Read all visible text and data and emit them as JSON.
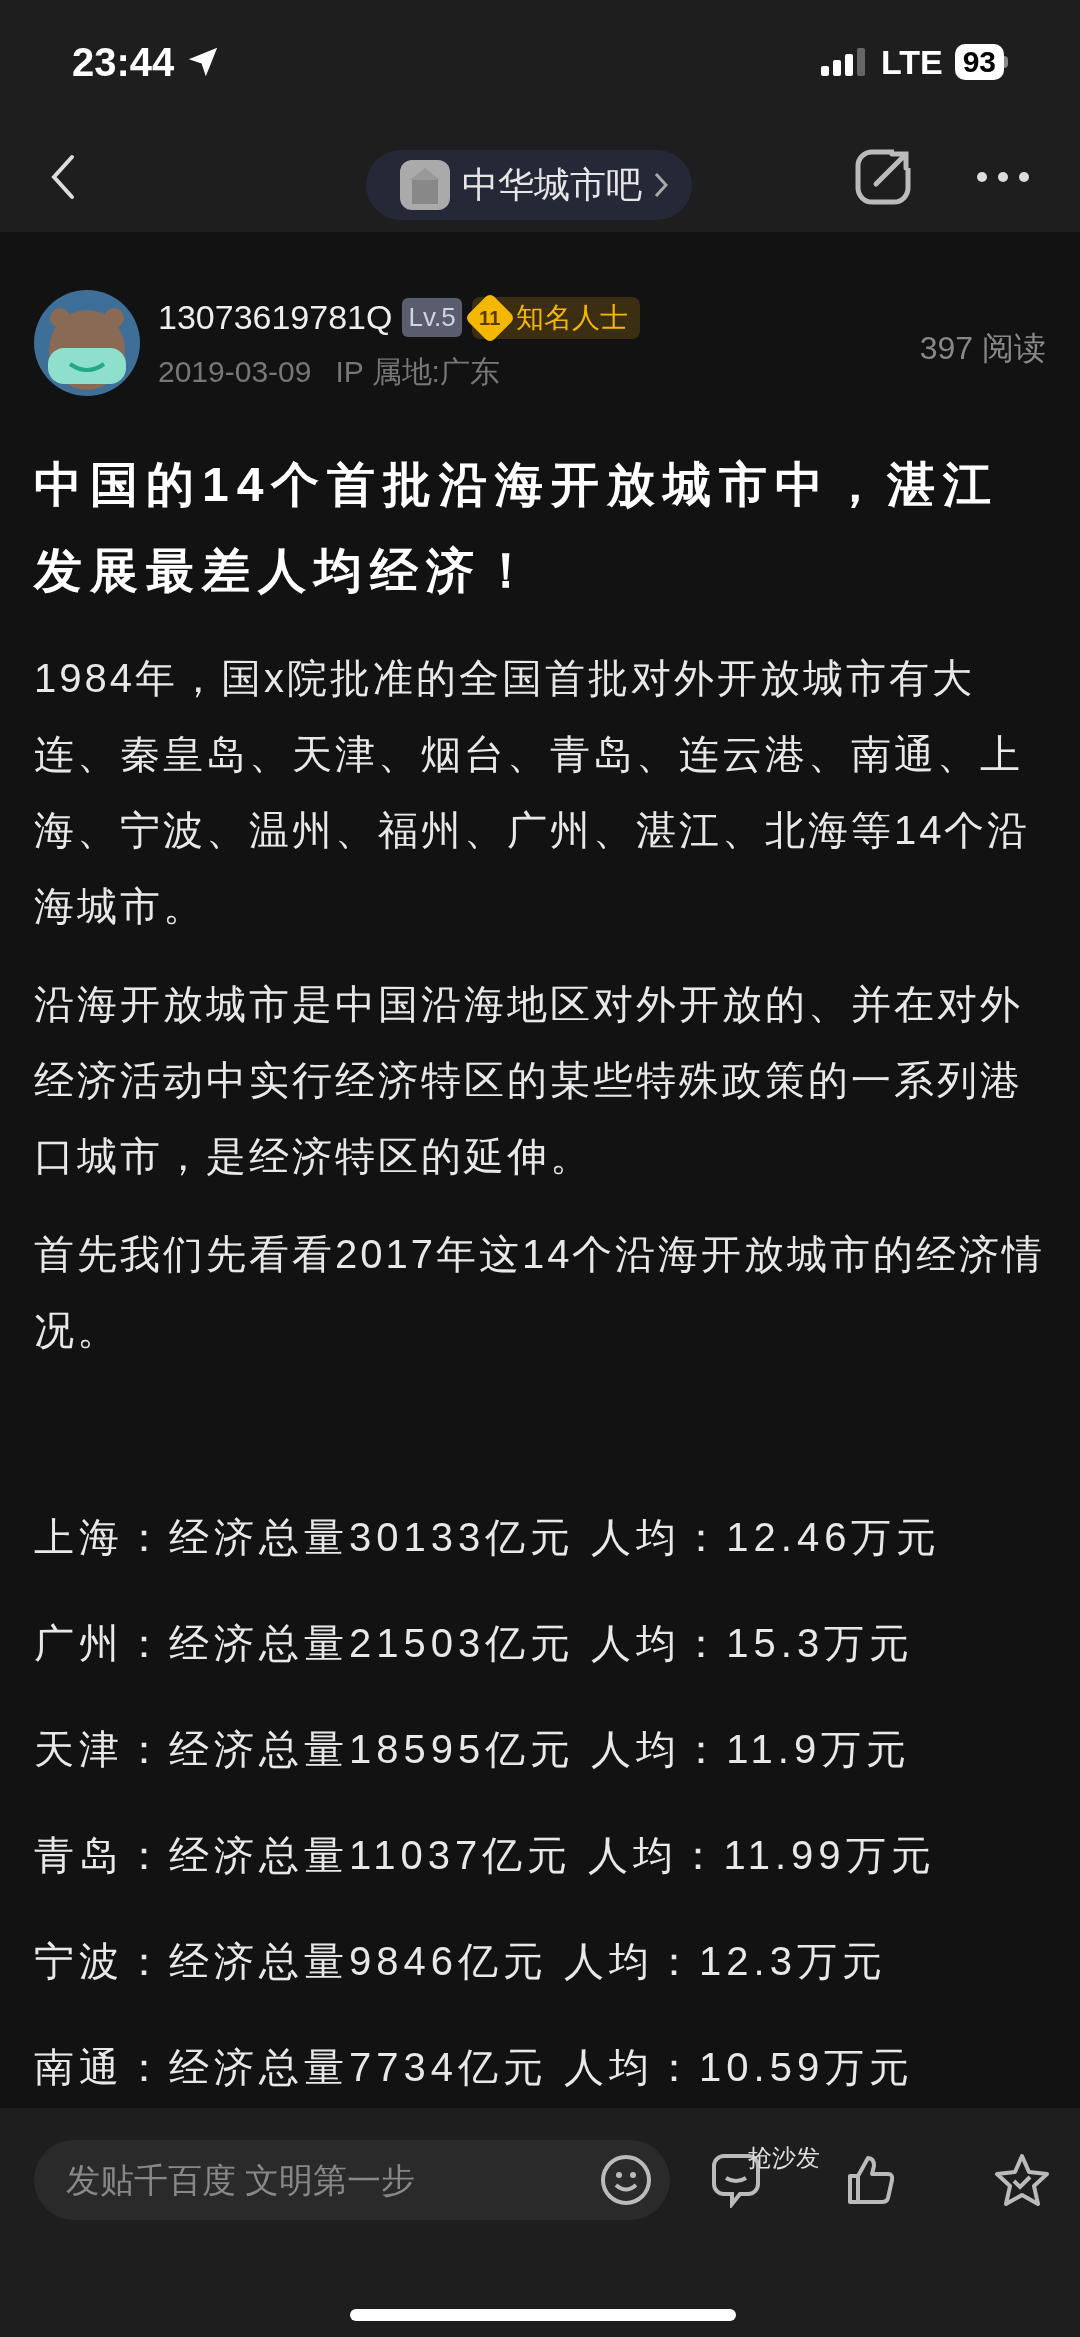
{
  "status_bar": {
    "time": "23:44",
    "network": "LTE",
    "battery": "93"
  },
  "header": {
    "forum": "中华城市吧"
  },
  "author": {
    "name": "13073619781Q",
    "level": "Lv.5",
    "badge_number": "11",
    "badge": "知名人士",
    "date": "2019-03-09",
    "ip": "IP 属地:广东",
    "reads": "397 阅读"
  },
  "post": {
    "title": "中国的14个首批沿海开放城市中，湛江发展最差人均经济！",
    "paragraphs": [
      "1984年，国x院批准的全国首批对外开放城市有大连、秦皇岛、天津、烟台、青岛、连云港、南通、上海、宁波、温州、福州、广州、湛江、北海等14个沿海城市。",
      "沿海开放城市是中国沿海地区对外开放的、并在对外经济活动中实行经济特区的某些特殊政策的一系列港口城市，是经济特区的延伸。",
      "首先我们先看看2017年这14个沿海开放城市的经济情况。"
    ],
    "lines": [
      "上海：经济总量30133亿元 人均：12.46万元",
      "广州：经济总量21503亿元 人均：15.3万元",
      "天津：经济总量18595亿元 人均：11.9万元",
      "青岛：经济总量11037亿元 人均：11.99万元",
      "宁波：经济总量9846亿元 人均：12.3万元",
      "南通：经济总量7734亿元 人均：10.59万元"
    ]
  },
  "bottom_bar": {
    "placeholder": "发贴千百度 文明第一步",
    "sofa": "抢沙发"
  }
}
